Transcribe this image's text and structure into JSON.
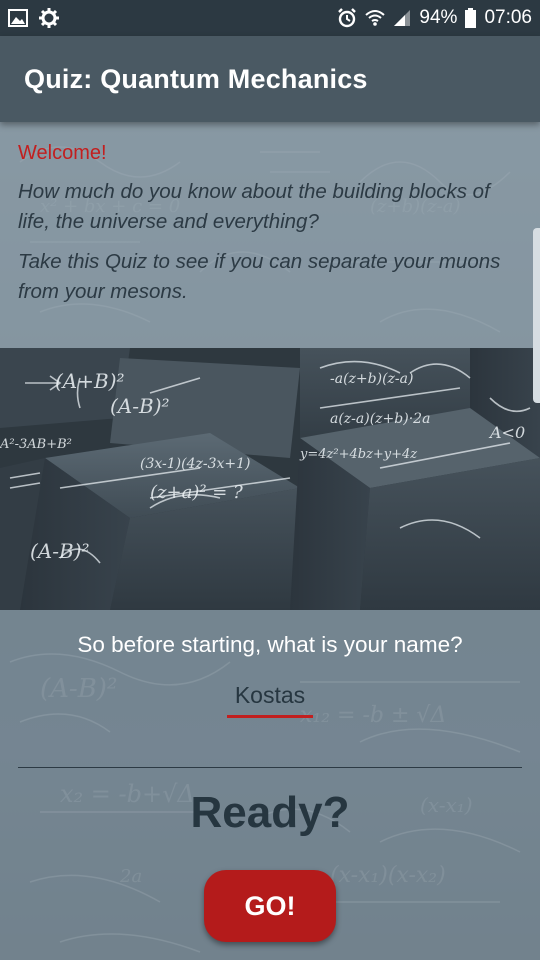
{
  "status_bar": {
    "left_icons": [
      "image-icon",
      "settings-sync-icon"
    ],
    "right_icons": [
      "alarm-icon",
      "wifi-icon",
      "signal-icon",
      "battery-icon"
    ],
    "battery": "94%",
    "time": "07:06"
  },
  "app_bar": {
    "title": "Quiz: Quantum Mechanics"
  },
  "intro": {
    "welcome": "Welcome!",
    "paragraph1": "How much do you know about the building blocks of life, the universe and everything?",
    "paragraph2": "Take this Quiz to see if you can separate your muons from your mesons."
  },
  "form": {
    "question": "So before starting, what is your name?",
    "name_value": "Kostas",
    "ready": "Ready?",
    "go_label": "GO!"
  },
  "colors": {
    "accent": "#c21f1f",
    "button": "#b41b1b",
    "app_bar": "#4a5963",
    "status_bar": "#2c3942"
  }
}
